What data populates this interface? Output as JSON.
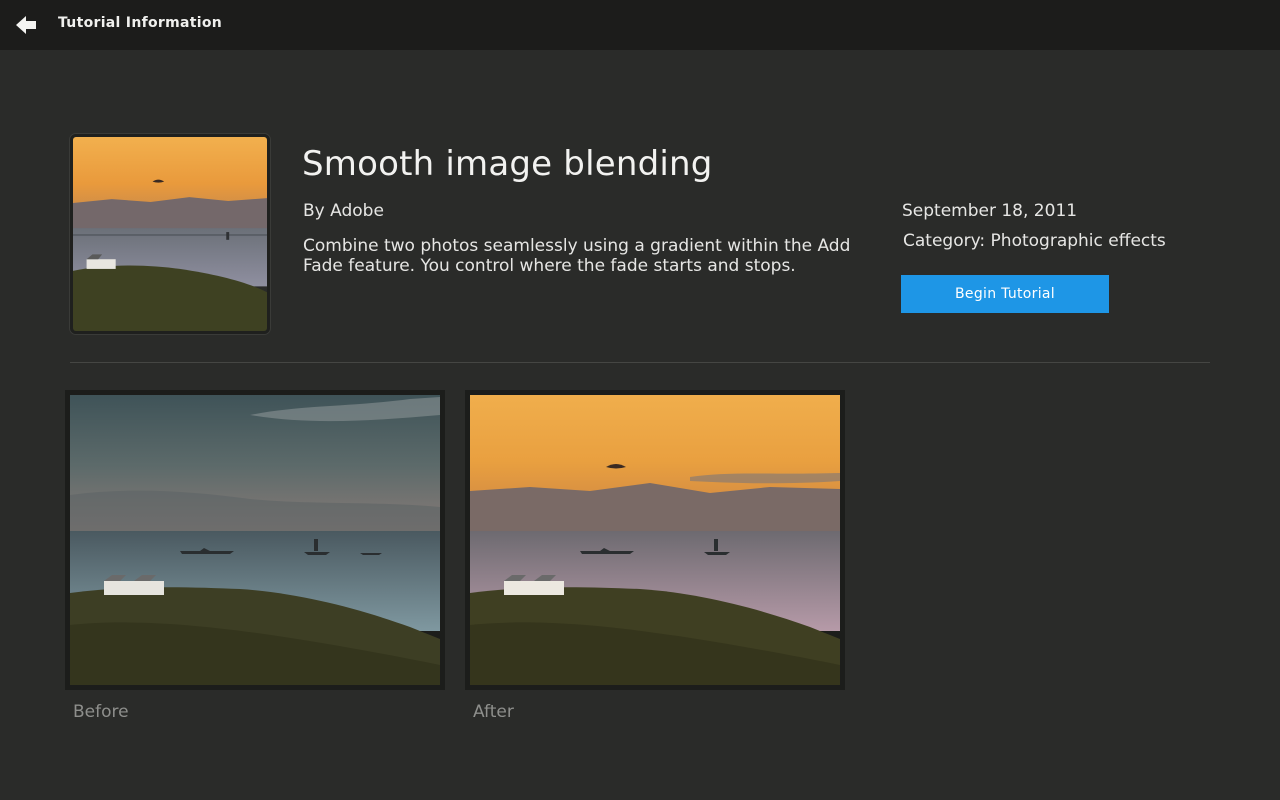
{
  "topbar": {
    "back_icon": "back-arrow-icon",
    "title": "Tutorial Information"
  },
  "tutorial": {
    "title": "Smooth image blending",
    "author": "By Adobe",
    "description": "Combine two photos seamlessly using a gradient within the Add Fade feature. You control where the fade starts and stops.",
    "date": "September 18, 2011",
    "category": "Category: Photographic effects",
    "begin_label": "Begin Tutorial",
    "accent_color": "#1e96e6"
  },
  "gallery": {
    "before_label": "Before",
    "after_label": "After"
  }
}
